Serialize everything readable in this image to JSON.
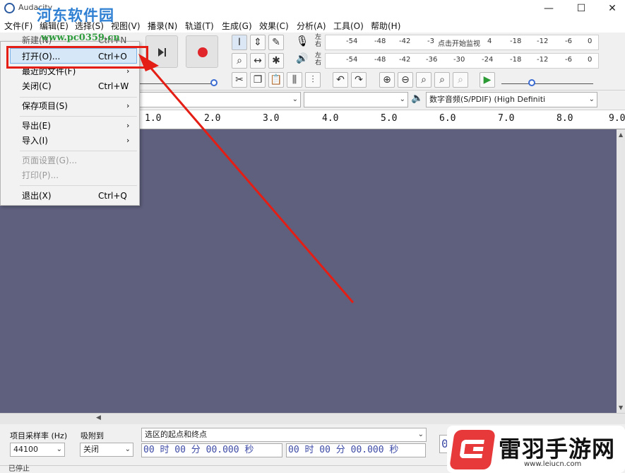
{
  "window": {
    "title": "Audacity",
    "min_btn": "—",
    "max_btn": "☐",
    "close_btn": "✕"
  },
  "menubar": {
    "items": [
      "文件(F)",
      "编辑(E)",
      "选择(S)",
      "视图(V)",
      "播录(N)",
      "轨道(T)",
      "生成(G)",
      "效果(C)",
      "分析(A)",
      "工具(O)",
      "帮助(H)"
    ]
  },
  "file_menu": {
    "items": [
      {
        "label": "新建(N)",
        "shortcut": "Ctrl+N"
      },
      {
        "label": "打开(O)...",
        "shortcut": "Ctrl+O"
      },
      {
        "label": "最近的文件(F)",
        "submenu": "›"
      },
      {
        "label": "关闭(C)",
        "shortcut": "Ctrl+W"
      },
      {
        "label": "保存项目(S)",
        "submenu": "›"
      },
      {
        "label": "导出(E)",
        "submenu": "›"
      },
      {
        "label": "导入(I)",
        "submenu": "›"
      },
      {
        "label": "页面设置(G)..."
      },
      {
        "label": "打印(P)..."
      },
      {
        "label": "退出(X)",
        "shortcut": "Ctrl+Q"
      }
    ]
  },
  "meter": {
    "record_ticks": [
      "-54",
      "-48",
      "-42",
      "-3",
      "点击开始监视",
      "4",
      "-18",
      "-12",
      "-6",
      "0"
    ],
    "play_ticks": [
      "-54",
      "-48",
      "-42",
      "-36",
      "-30",
      "-24",
      "-18",
      "-12",
      "-6",
      "0"
    ],
    "left": "左",
    "right": "右"
  },
  "device": {
    "playback_device": "数字音频(S/PDIF) (High Definiti"
  },
  "ruler": {
    "ticks": [
      "1.0",
      "2.0",
      "3.0",
      "4.0",
      "5.0",
      "6.0",
      "7.0",
      "8.0",
      "9.0"
    ]
  },
  "bottom": {
    "rate_label": "项目采样率 (Hz)",
    "rate_value": "44100",
    "snap_label": "吸附到",
    "snap_value": "关闭",
    "selection_label": "选区的起点和终点",
    "time_start": "00 时 00 分 00.000 秒",
    "time_end": "00 时 00 分 00.000 秒",
    "time_partial": "0",
    "status": "已停止"
  },
  "watermarks": {
    "top_brand": "河东软件园",
    "top_url": "www.pc0359.cn",
    "bottom_brand": "雷羽手游网",
    "bottom_url": "www.leiucn.com"
  },
  "colors": {
    "track_bg": "#5f607e",
    "highlight": "#e41e14",
    "time_text": "#3c4aa6",
    "record": "#e0262b",
    "play_green": "#2d9b35"
  }
}
